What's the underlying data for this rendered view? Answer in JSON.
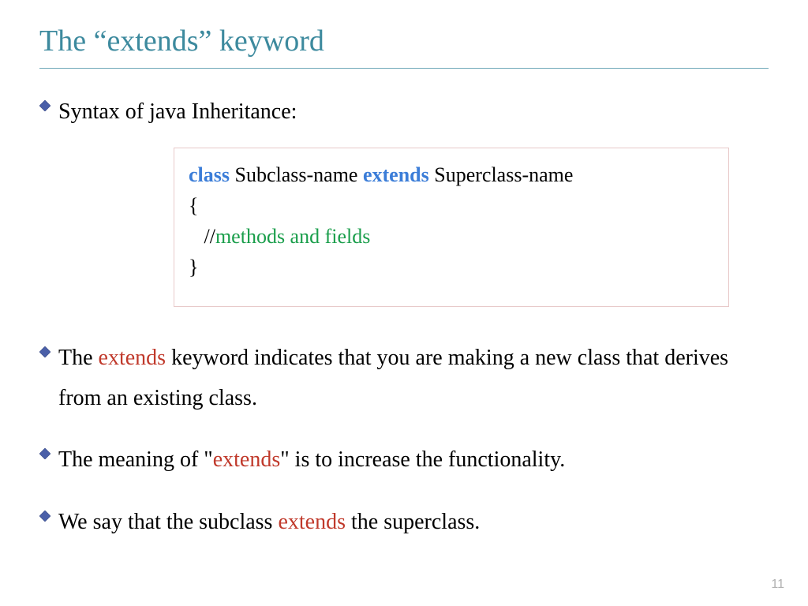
{
  "title": "The “extends” keyword",
  "bullets": {
    "b1": "Syntax of java Inheritance:",
    "b2_pre": "The ",
    "b2_kw": "extends",
    "b2_post": " keyword indicates that you are making a new class that derives from an existing class.",
    "b3_pre": " The meaning of \"",
    "b3_kw": "extends",
    "b3_post": "\" is to increase the functionality.",
    "b4_pre": " We say that the subclass ",
    "b4_kw": "extends",
    "b4_post": " the superclass."
  },
  "code": {
    "kw_class": "class",
    "subclass": " Subclass-name ",
    "kw_extends": "extends",
    "superclass": " Superclass-name",
    "brace_open": "{",
    "comment_prefix": "   //",
    "comment_text": "methods and fields",
    "brace_close": "}"
  },
  "page_number": "11",
  "colors": {
    "title": "#3d8a9e",
    "keyword_blue": "#3b7dd8",
    "keyword_green": "#1a9e4b",
    "keyword_red": "#c0392b"
  }
}
